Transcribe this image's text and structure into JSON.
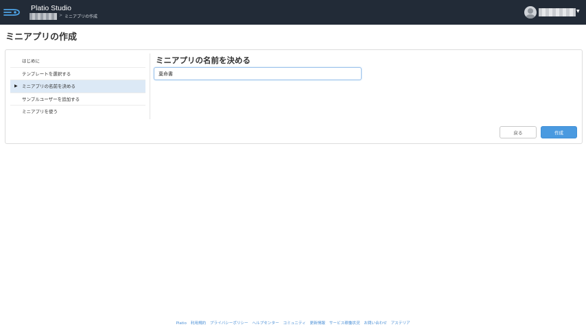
{
  "app": {
    "title": "Platio Studio",
    "breadcrumb_separator": ">",
    "breadcrumb_current": "ミニアプリの作成"
  },
  "page": {
    "title": "ミニアプリの作成"
  },
  "steps": [
    {
      "label": "はじめに",
      "active": false
    },
    {
      "label": "テンプレートを選択する",
      "active": false
    },
    {
      "label": "ミニアプリの名前を決める",
      "active": true
    },
    {
      "label": "サンプルユーザーを追加する",
      "active": false
    },
    {
      "label": "ミニアプリを使う",
      "active": false
    }
  ],
  "active_marker": "▶",
  "main": {
    "section_title": "ミニアプリの名前を決める",
    "name_value": "稟命書"
  },
  "buttons": {
    "back": "戻る",
    "create": "作成"
  },
  "footer": {
    "links": [
      "Platio",
      "利用規約",
      "プライバシーポリシー",
      "ヘルプセンター",
      "コミュニティ",
      "更新情報",
      "サービス稼働状況",
      "お問い合わせ",
      "アステリア"
    ]
  },
  "colors": {
    "topbar": "#222b37",
    "accent": "#4a9ae0",
    "active_step": "#dce9f6",
    "link": "#4a8fd6"
  },
  "icons": {
    "logo": "platio-logo-icon",
    "avatar": "user-avatar-icon",
    "user_menu": "chevron-down-icon"
  }
}
